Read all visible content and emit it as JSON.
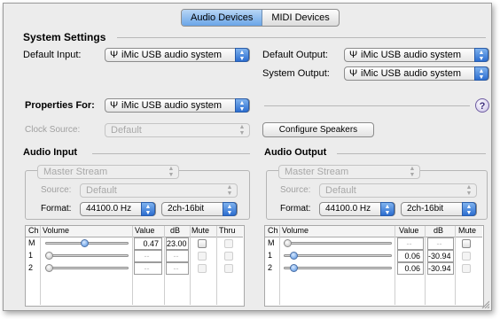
{
  "tabs": [
    {
      "label": "Audio Devices",
      "active": true
    },
    {
      "label": "MIDI Devices",
      "active": false
    }
  ],
  "system_settings": {
    "heading": "System Settings",
    "default_input_label": "Default Input:",
    "default_input_value": "iMic USB audio system",
    "default_output_label": "Default Output:",
    "default_output_value": "iMic USB audio system",
    "system_output_label": "System Output:",
    "system_output_value": "iMic USB audio system"
  },
  "properties": {
    "label": "Properties For:",
    "value": "iMic USB audio system",
    "help": "?",
    "clock_source_label": "Clock Source:",
    "clock_source_value": "Default",
    "configure_button": "Configure Speakers"
  },
  "audio_input": {
    "heading": "Audio Input",
    "stream": "Master Stream",
    "source_label": "Source:",
    "source_value": "Default",
    "format_label": "Format:",
    "format_rate": "44100.0 Hz",
    "format_bits": "2ch-16bit",
    "columns": [
      "Ch",
      "Volume",
      "Value",
      "dB",
      "Mute",
      "Thru"
    ],
    "rows": [
      {
        "ch": "M",
        "volume": 0.47,
        "value": "0.47",
        "db": "23.00",
        "mute_enabled": true,
        "thru_enabled": false
      },
      {
        "ch": "1",
        "volume": 0.0,
        "value": "--",
        "db": "--",
        "mute_enabled": false,
        "thru_enabled": false
      },
      {
        "ch": "2",
        "volume": 0.0,
        "value": "--",
        "db": "--",
        "mute_enabled": false,
        "thru_enabled": false
      }
    ]
  },
  "audio_output": {
    "heading": "Audio Output",
    "stream": "Master Stream",
    "source_label": "Source:",
    "source_value": "Default",
    "format_label": "Format:",
    "format_rate": "44100.0 Hz",
    "format_bits": "2ch-16bit",
    "columns": [
      "Ch",
      "Volume",
      "Value",
      "dB",
      "Mute"
    ],
    "rows": [
      {
        "ch": "M",
        "volume": 0.0,
        "value": "--",
        "db": "--",
        "mute_enabled": true
      },
      {
        "ch": "1",
        "volume": 0.06,
        "value": "0.06",
        "db": "-30.94",
        "mute_enabled": false
      },
      {
        "ch": "2",
        "volume": 0.06,
        "value": "0.06",
        "db": "-30.94",
        "mute_enabled": false
      }
    ]
  },
  "colors": {
    "accent": "#4e8fe0",
    "background": "#ececec"
  },
  "icons": {
    "usb": "usb-icon",
    "popup": "popup-arrows-icon",
    "help": "help-icon"
  }
}
